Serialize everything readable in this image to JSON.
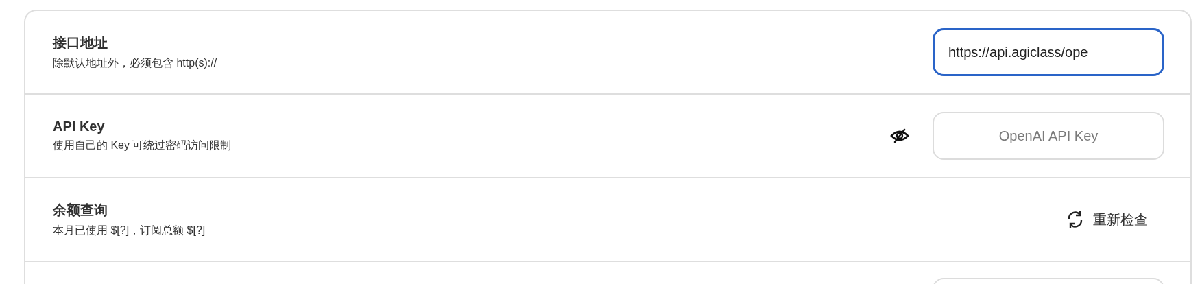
{
  "settings": [
    {
      "kind": "text-field",
      "title": "接口地址",
      "subtitle": "除默认地址外，必须包含 http(s)://",
      "value": "https://api.agiclass/ope",
      "focused": true
    },
    {
      "kind": "password-field",
      "title": "API Key",
      "subtitle": "使用自己的 Key 可绕过密码访问限制",
      "placeholder": "OpenAI API Key"
    },
    {
      "kind": "action",
      "title": "余额查询",
      "subtitle": "本月已使用 $[?]，订阅总额 $[?]",
      "action": "重新检查"
    },
    {
      "kind": "cut-field"
    }
  ]
}
